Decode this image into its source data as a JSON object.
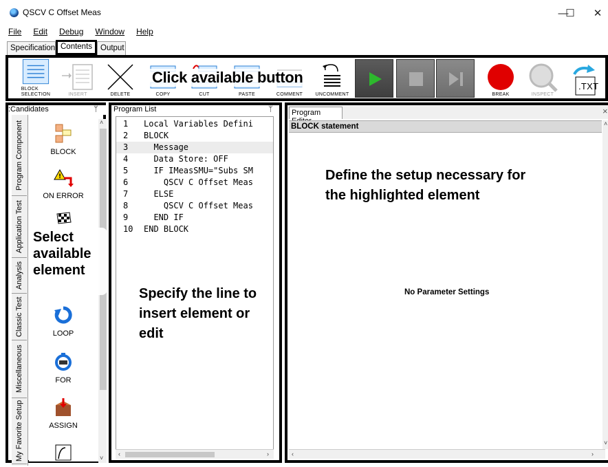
{
  "window": {
    "title": "QSCV C Offset Meas",
    "minimize": "—",
    "maximize": "☐",
    "close": "✕"
  },
  "menu": [
    {
      "label": "File",
      "mnemonic": "F"
    },
    {
      "label": "Edit",
      "mnemonic": "E"
    },
    {
      "label": "Debug",
      "mnemonic": "D"
    },
    {
      "label": "Window",
      "mnemonic": "W"
    },
    {
      "label": "Help",
      "mnemonic": "H"
    }
  ],
  "tabs": {
    "specification": "Specification",
    "contents": "Contents",
    "output": "Output",
    "active": "Contents"
  },
  "toolbar": {
    "block_selection": "BLOCK\nSELECTION",
    "insert": "INSERT",
    "delete": "DELETE",
    "copy": "COPY",
    "cut": "CUT",
    "paste": "PASTE",
    "comment": "COMMENT",
    "uncomment": "UNCOMMENT",
    "break": "BREAK",
    "inspect": "INSPECT",
    "txt": ".TXT",
    "callout": "Click available button"
  },
  "candidates": {
    "header": ":Candidates",
    "pin": "ᛘ",
    "vtabs": [
      "Program Component",
      "Application Test",
      "Analysis",
      "Classic Test",
      "Miscellaneous",
      "My Favorite Setup"
    ],
    "items": [
      "BLOCK",
      "ON ERROR",
      "",
      "",
      "LOOP",
      "FOR",
      "ASSIGN",
      ""
    ],
    "callout": "Select available element"
  },
  "program_list": {
    "header": "Program List",
    "pin": "ᛘ",
    "lines": [
      {
        "num": "1",
        "text": "Local Variables Defini"
      },
      {
        "num": "2",
        "text": "BLOCK"
      },
      {
        "num": "3",
        "text": "  Message"
      },
      {
        "num": "4",
        "text": "  Data Store: OFF"
      },
      {
        "num": "5",
        "text": "  IF IMeasSMU=\"Subs SM"
      },
      {
        "num": "6",
        "text": "    QSCV C Offset Meas"
      },
      {
        "num": "7",
        "text": "  ELSE"
      },
      {
        "num": "8",
        "text": "    QSCV C Offset Meas"
      },
      {
        "num": "9",
        "text": "  END IF"
      },
      {
        "num": "10",
        "text": "END BLOCK"
      }
    ],
    "highlighted_line": "3",
    "callout": "Specify the line to insert element or edit"
  },
  "program_editor": {
    "tab": "Program Editor",
    "close": "×",
    "section": "BLOCK statement",
    "no_params": "No Parameter Settings",
    "callout": "Define the setup necessary for the highlighted element"
  },
  "colors": {
    "run_green": "#2db82d",
    "break_red": "#e00000",
    "toolbar_blue": "#2a7fd4",
    "callout_border": "#000000"
  }
}
